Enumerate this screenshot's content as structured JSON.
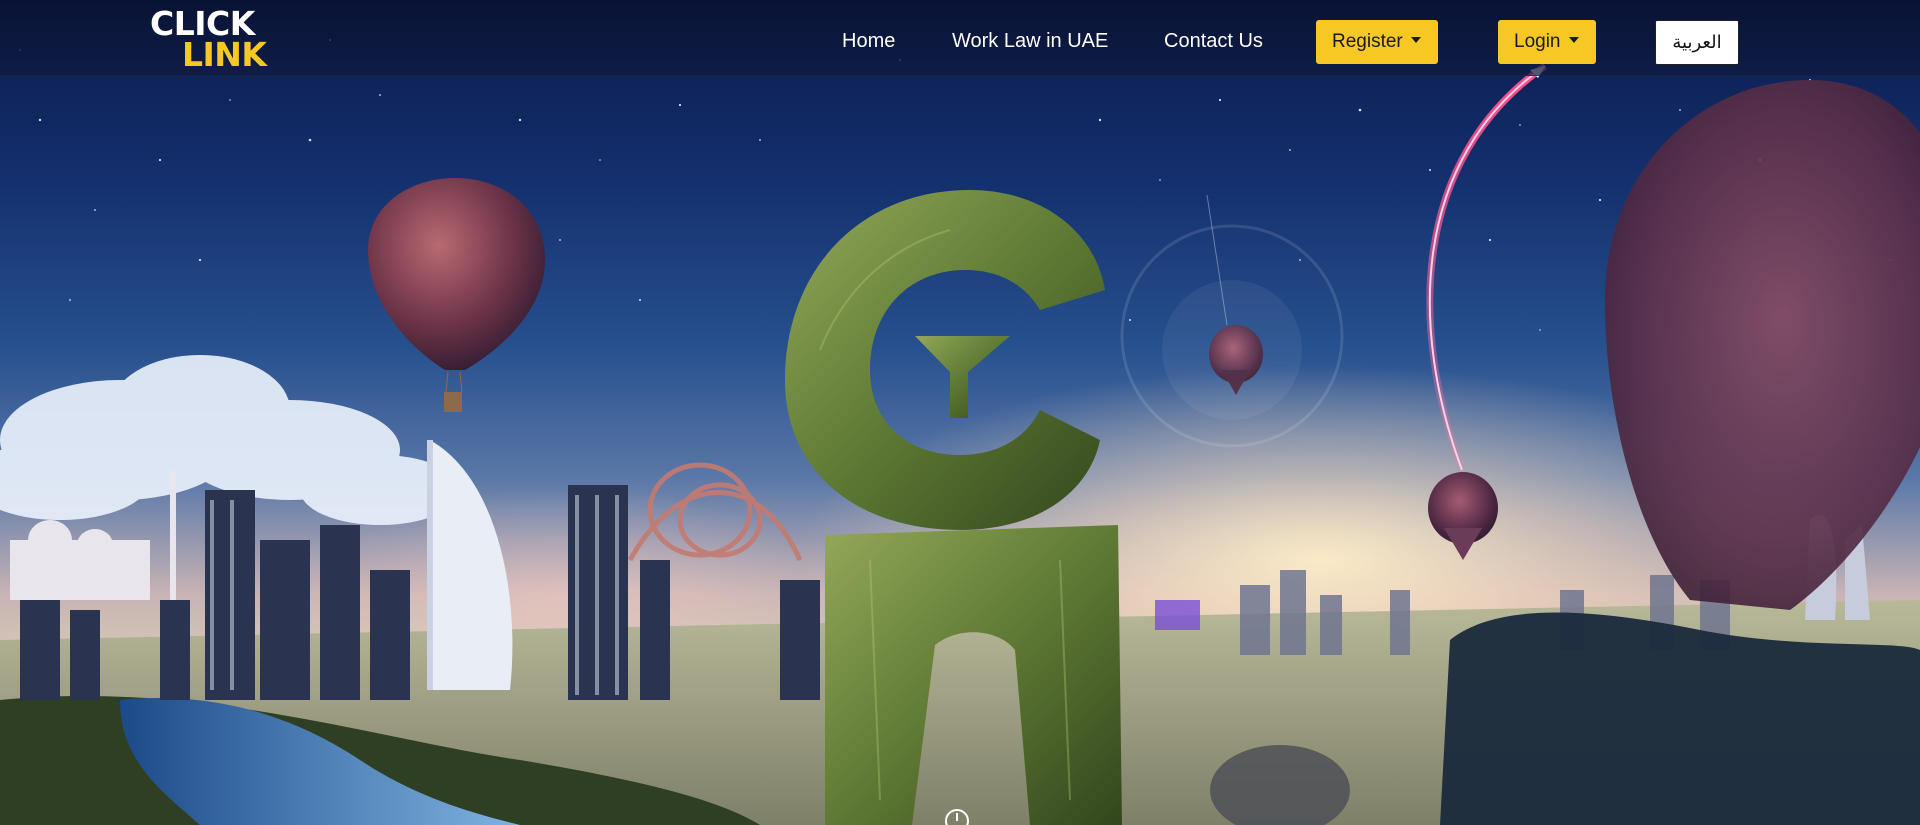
{
  "header": {
    "logo": {
      "line1": "CLICK",
      "line2": "LINK"
    },
    "nav": {
      "home": "Home",
      "work_law": "Work Law in UAE",
      "contact": "Contact Us"
    },
    "register_label": "Register",
    "login_label": "Login",
    "language_label": "العربية"
  },
  "hero": {
    "image": "dubai-skyline-with-green-grass-logo-letters-and-hot-air-balloons",
    "icons": [
      "scroll-down-icon"
    ]
  },
  "colors": {
    "accent": "#f7c824",
    "header_bg": "#0e1a40",
    "nav_text": "#ffffff"
  }
}
